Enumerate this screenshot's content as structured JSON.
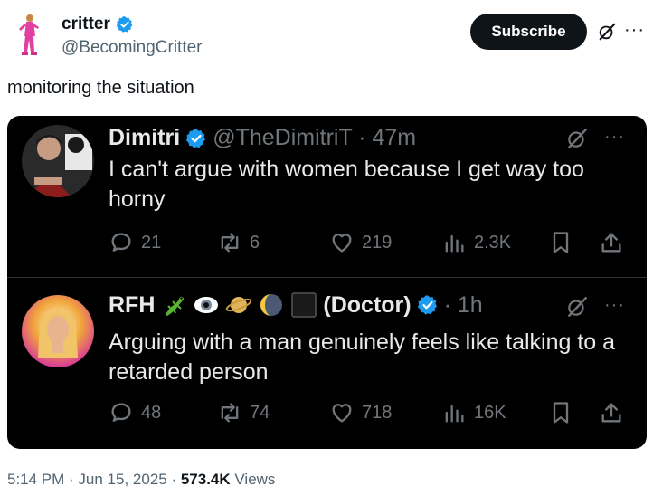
{
  "author": {
    "display_name": "critter",
    "handle": "@BecomingCritter",
    "verified": true,
    "verified_color": "#1d9bf0"
  },
  "subscribe_label": "Subscribe",
  "tweet_text": "monitoring the situation",
  "embedded": {
    "post1": {
      "name": "Dimitri",
      "handle_time": "@TheDimitriT · 47m",
      "text": "I can't argue with women because I get way too horny",
      "replies": "21",
      "reposts": "6",
      "likes": "219",
      "views": "2.3K"
    },
    "post2": {
      "name": "RFH",
      "emoji": [
        "lizard",
        "eye",
        "saturn",
        "moon",
        "black-square"
      ],
      "name_suffix": "(Doctor)",
      "time": "· 1h",
      "text": "Arguing with a man genuinely feels like talking to a retarded person",
      "replies": "48",
      "reposts": "74",
      "likes": "718",
      "views": "16K"
    }
  },
  "footer": {
    "time": "5:14 PM · Jun 15, 2025 · ",
    "views_count": "573.4K",
    "views_label": " Views"
  },
  "colors": {
    "text": "#0f1419",
    "muted": "#536471",
    "dark_bg": "#000000",
    "dark_text": "#e7e9ea",
    "dark_muted": "#71767b"
  }
}
